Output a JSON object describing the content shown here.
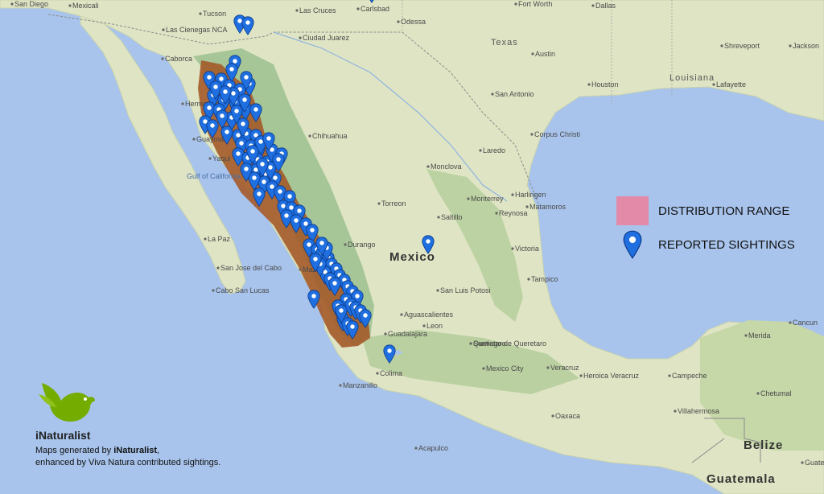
{
  "legend": {
    "range_label": "DISTRIBUTION RANGE",
    "sightings_label": "REPORTED SIGHTINGS",
    "range_color": "#e28aa8",
    "marker_color": "#1f6fe0"
  },
  "branding": {
    "logo_name": "iNaturalist",
    "credit_prefix": "Maps generated by ",
    "credit_brand": "iNaturalist",
    "credit_suffix": ",",
    "credit_line2": "enhanced by Viva Natura contributed sightings.",
    "logo_color": "#74ac00"
  },
  "map": {
    "colors": {
      "ocean": "#a8c4ec",
      "land": "#dfe5c4",
      "highland": "#b9cfa0",
      "sierra": "#7fae82",
      "range_fill": "#a45a2a"
    },
    "countries": {
      "mexico": "Mexico",
      "belize": "Belize",
      "guatemala": "Guatemala"
    },
    "states": {
      "texas": "Texas",
      "louisiana": "Louisiana"
    },
    "waters": {
      "gulf": "Gulf of California"
    },
    "places": [
      "San Diego",
      "Mexicali",
      "Tucson",
      "Las Cienegas NCA",
      "Las Cruces",
      "Carlsbad",
      "Odessa",
      "Ciudad Juarez",
      "Caborca",
      "Hermosillo",
      "Guaymas",
      "Chihuahua",
      "Yaqui",
      "Monclova",
      "Torreon",
      "Saltillo",
      "Monterrey",
      "Durango",
      "Mazatlan",
      "San Jose del Cabo",
      "Cabo San Lucas",
      "La Paz",
      "San Luis Potosi",
      "Aguascalientes",
      "Leon",
      "Guadalajara",
      "Queretaro",
      "Mexico City",
      "Santiago de Queretaro",
      "Colima",
      "Manzanillo",
      "Veracruz",
      "Acapulco",
      "Oaxaca",
      "Villahermosa",
      "Merida",
      "Cancun",
      "Fort Worth",
      "Dallas",
      "Shreveport",
      "Jackson",
      "Austin",
      "San Antonio",
      "Houston",
      "Lafayette",
      "Corpus Christi",
      "Laredo",
      "Harlingen",
      "Matamoros",
      "Reynosa",
      "Victoria",
      "Tampico",
      "Heroica Veracruz",
      "Campeche",
      "Chetumal",
      "Guatemala City"
    ],
    "sightings_count": 95
  }
}
